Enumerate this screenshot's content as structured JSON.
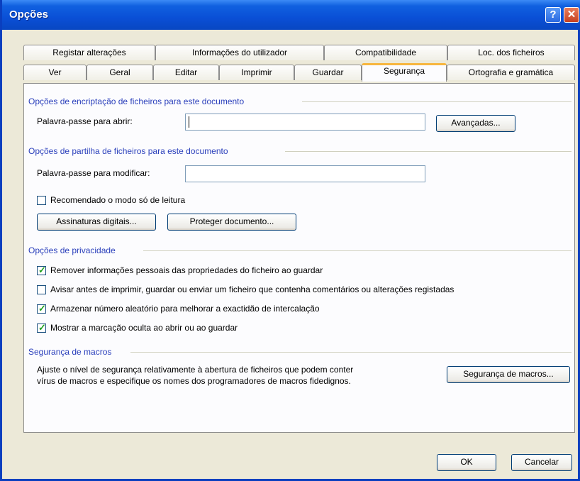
{
  "window": {
    "title": "Opções",
    "help_label": "?",
    "close_label": "✕"
  },
  "tabs_back": [
    {
      "label": "Registar alterações"
    },
    {
      "label": "Informações do utilizador"
    },
    {
      "label": "Compatibilidade"
    },
    {
      "label": "Loc. dos ficheiros"
    }
  ],
  "tabs_front": [
    {
      "label": "Ver"
    },
    {
      "label": "Geral"
    },
    {
      "label": "Editar"
    },
    {
      "label": "Imprimir"
    },
    {
      "label": "Guardar"
    },
    {
      "label": "Segurança",
      "active": true
    },
    {
      "label": "Ortografia e gramática"
    }
  ],
  "encryption": {
    "heading": "Opções de encriptação de ficheiros para este documento",
    "password_open_label": "Palavra-passe para abrir:",
    "password_open_value": "",
    "advanced_button": "Avançadas..."
  },
  "sharing": {
    "heading": "Opções de partilha de ficheiros para este documento",
    "password_modify_label": "Palavra-passe para modificar:",
    "password_modify_value": "",
    "readonly_label": "Recomendado o modo só de leitura",
    "readonly_checked": false,
    "signatures_button": "Assinaturas digitais...",
    "protect_button": "Proteger documento..."
  },
  "privacy": {
    "heading": "Opções de privacidade",
    "options": [
      {
        "label": "Remover informações pessoais das propriedades do ficheiro ao guardar",
        "checked": true
      },
      {
        "label": "Avisar antes de imprimir, guardar ou enviar um ficheiro que contenha comentários ou alterações registadas",
        "checked": false
      },
      {
        "label": "Armazenar número aleatório para melhorar a exactidão de intercalação",
        "checked": true
      },
      {
        "label": "Mostrar a marcação oculta ao abrir ou ao guardar",
        "checked": true
      }
    ]
  },
  "macros": {
    "heading": "Segurança de macros",
    "description_line1": "Ajuste o nível de segurança relativamente à abertura de ficheiros que podem conter",
    "description_line2": "vírus de macros e especifique os nomes dos programadores de macros fidedignos.",
    "button": "Segurança de macros..."
  },
  "footer": {
    "ok": "OK",
    "cancel": "Cancelar"
  },
  "colors": {
    "title_bar": "#0a4fd6",
    "group_heading": "#2a3fbb",
    "active_tab_accent": "#f7b63e",
    "checkmark": "#21a121"
  }
}
